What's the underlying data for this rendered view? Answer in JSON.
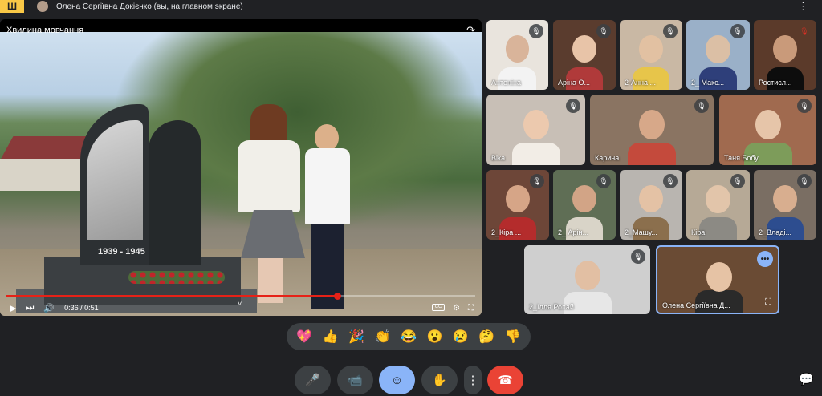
{
  "topbar": {
    "logo_glyph": "Ш",
    "presenter_text": "Олена Сергіївна Докієнко (вы, на главном экране)",
    "more_glyph": "⋮"
  },
  "stage": {
    "video_title": "Хвилина мовчання",
    "share_glyph": "↷",
    "monument_years": "1939 - 1945",
    "time": "0:36 / 0:51",
    "progress": 0.7059,
    "play_glyph": "▶",
    "next_glyph": "⏭",
    "volume_glyph": "🔊",
    "chevron_glyph": "˅",
    "cc_label": "CC",
    "settings_glyph": "⚙",
    "fullscreen_glyph": "⛶"
  },
  "participants": [
    {
      "name": "Антоніна",
      "muted": true
    },
    {
      "name": "Аріна О...",
      "muted": true
    },
    {
      "name": "2-Анна ...",
      "muted": true
    },
    {
      "name": "2_ Макс...",
      "muted": true
    },
    {
      "name": "Ростисл...",
      "muted": true,
      "mute_color": "#d93025"
    },
    {
      "name": "Віка",
      "muted": true
    },
    {
      "name": "Карина",
      "muted": true
    },
    {
      "name": "Таня Бобу",
      "muted": true
    },
    {
      "name": "2_Кіра ...",
      "muted": true
    },
    {
      "name": "2_ Арін...",
      "muted": true
    },
    {
      "name": "2_Машу...",
      "muted": true
    },
    {
      "name": "Кіра",
      "muted": true
    },
    {
      "name": "2_Владі...",
      "muted": true
    },
    {
      "name": "2_Ілля Ропай",
      "muted": true
    },
    {
      "name": "Олена Сергіївна Д...",
      "muted": false,
      "self": true
    }
  ],
  "icons": {
    "mic_off": "🎙",
    "more_dots": "•••",
    "crop": "⛶"
  },
  "reactions": [
    "💖",
    "👍",
    "🎉",
    "👏",
    "😂",
    "😮",
    "😢",
    "🤔",
    "👎"
  ],
  "controls": {
    "mic": "🎤",
    "camera": "📹",
    "emoji": "☺",
    "raise_hand": "✋",
    "more": "⋮",
    "hangup": "☎",
    "chat": "💬"
  }
}
